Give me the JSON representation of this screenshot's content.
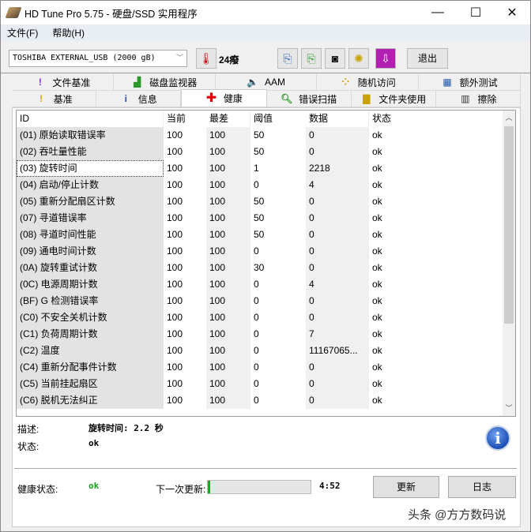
{
  "title": "HD Tune Pro 5.75 - 硬盘/SSD 实用程序",
  "window_controls": {
    "minimize": "—",
    "maximize": "☐",
    "close": "✕"
  },
  "menu": [
    "文件(F)",
    "帮助(H)"
  ],
  "toolbar": {
    "drive": "TOSHIBA EXTERNAL_USB (2000 gB)",
    "temperature": "24癈",
    "exit": "退出"
  },
  "tabs_top": [
    "文件基准",
    "磁盘监视器",
    "AAM",
    "随机访问",
    "额外测试"
  ],
  "tabs_bottom": [
    "基准",
    "信息",
    "健康",
    "错误扫描",
    "文件夹使用",
    "擦除"
  ],
  "active_tab": "健康",
  "table": {
    "headers": [
      "ID",
      "当前",
      "最差",
      "阈值",
      "数据",
      "状态"
    ],
    "rows": [
      [
        "(01) 原始读取错误率",
        "100",
        "100",
        "50",
        "0",
        "ok"
      ],
      [
        "(02) 吞吐量性能",
        "100",
        "100",
        "50",
        "0",
        "ok"
      ],
      [
        "(03) 旋转时间",
        "100",
        "100",
        "1",
        "2218",
        "ok"
      ],
      [
        "(04) 启动/停止计数",
        "100",
        "100",
        "0",
        "4",
        "ok"
      ],
      [
        "(05) 重新分配扇区计数",
        "100",
        "100",
        "50",
        "0",
        "ok"
      ],
      [
        "(07) 寻道错误率",
        "100",
        "100",
        "50",
        "0",
        "ok"
      ],
      [
        "(08) 寻道时间性能",
        "100",
        "100",
        "50",
        "0",
        "ok"
      ],
      [
        "(09) 通电时间计数",
        "100",
        "100",
        "0",
        "0",
        "ok"
      ],
      [
        "(0A) 旋转重试计数",
        "100",
        "100",
        "30",
        "0",
        "ok"
      ],
      [
        "(0C) 电源周期计数",
        "100",
        "100",
        "0",
        "4",
        "ok"
      ],
      [
        "(BF) G 检测错误率",
        "100",
        "100",
        "0",
        "0",
        "ok"
      ],
      [
        "(C0) 不安全关机计数",
        "100",
        "100",
        "0",
        "0",
        "ok"
      ],
      [
        "(C1) 负荷周期计数",
        "100",
        "100",
        "0",
        "7",
        "ok"
      ],
      [
        "(C2) 温度",
        "100",
        "100",
        "0",
        "11167065...",
        "ok"
      ],
      [
        "(C4) 重新分配事件计数",
        "100",
        "100",
        "0",
        "0",
        "ok"
      ],
      [
        "(C5) 当前挂起扇区",
        "100",
        "100",
        "0",
        "0",
        "ok"
      ],
      [
        "(C6) 脱机无法纠正",
        "100",
        "100",
        "0",
        "0",
        "ok"
      ]
    ]
  },
  "details": {
    "desc_label": "描述:",
    "desc_value": "旋转时间: 2.2 秒",
    "status_label": "状态:",
    "status_value": "ok"
  },
  "footer": {
    "health_label": "健康状态:",
    "health_value": "ok",
    "next_update_label": "下一次更新:",
    "progress_percent": 2,
    "countdown": "4:52",
    "refresh": "更新",
    "log": "日志"
  },
  "watermark": "头条 @方方数码说",
  "colors": {
    "ok_green": "#1a9c1a",
    "progress": "#06b025"
  }
}
